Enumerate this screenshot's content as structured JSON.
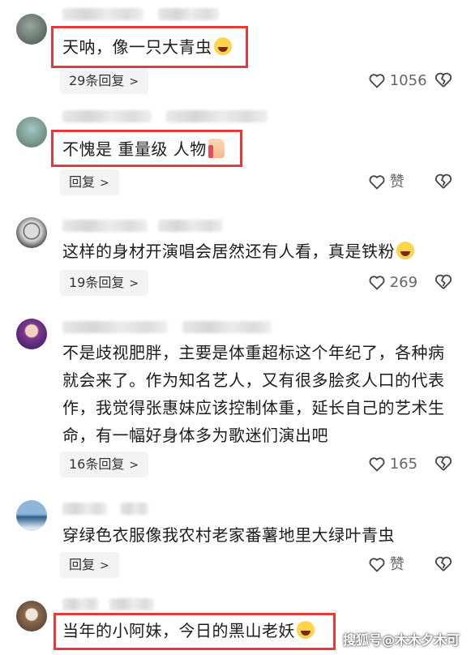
{
  "comments": [
    {
      "text": "天呐，像一只大青虫",
      "replies": "29条回复",
      "likes": "1056",
      "emoji": "laughing-cry"
    },
    {
      "text": "不愧是 重量级 人物",
      "replies": "回复",
      "likes": "赞",
      "emoji": "thumbs-up"
    },
    {
      "text": "这样的身材开演唱会居然还有人看，真是铁粉",
      "replies": "19条回复",
      "likes": "269",
      "emoji": "laughing-cry"
    },
    {
      "text": "不是歧视肥胖，主要是体重超标这个年纪了，各种病就会来了。作为知名艺人，又有很多脍炙人口的代表作，我觉得张惠妹应该控制体重，延长自己的艺术生命，有一幅好身体多为歌迷们演出吧",
      "replies": "16条回复",
      "likes": "165"
    },
    {
      "text": "穿绿色衣服像我农村老家番薯地里大绿叶青虫",
      "replies": "回复",
      "likes": "赞"
    },
    {
      "text": "当年的小阿妹，今日的黑山老妖",
      "emoji": "laughing-cry"
    }
  ],
  "watermark": "搜狐号@木木夕木可",
  "colors": {
    "highlight": "#e43a3a",
    "pill_bg": "#f3f3f3",
    "text": "#1c1c1c",
    "meta": "#666666"
  }
}
